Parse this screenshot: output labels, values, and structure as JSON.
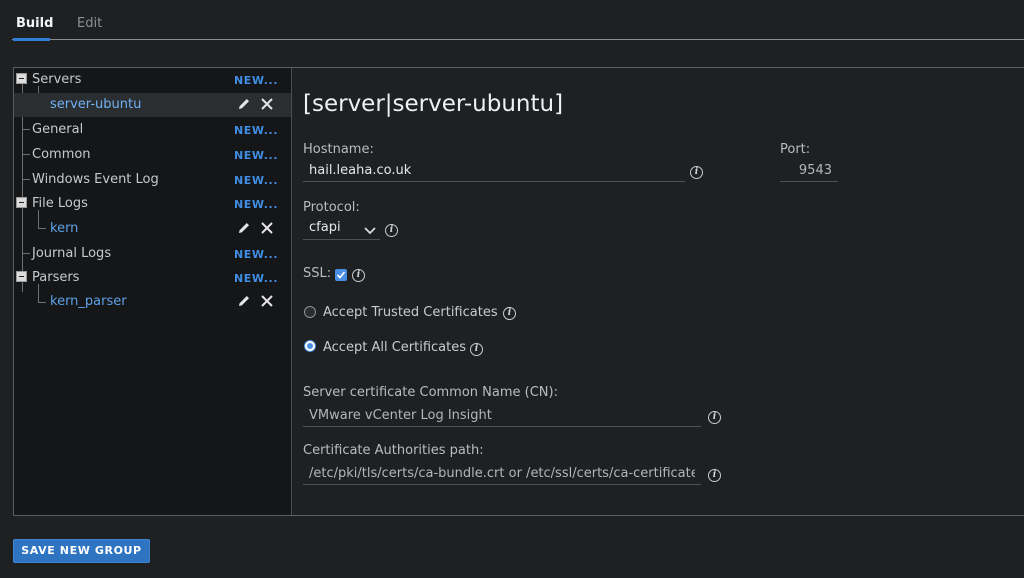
{
  "tabs": [
    {
      "label": "Build",
      "active": true
    },
    {
      "label": "Edit",
      "active": false
    }
  ],
  "tree": {
    "new_label": "NEW...",
    "servers": {
      "label": "Servers",
      "children": [
        {
          "label": "server-ubuntu",
          "selected": true
        }
      ]
    },
    "general": {
      "label": "General"
    },
    "common": {
      "label": "Common"
    },
    "windows_event_log": {
      "label": "Windows Event Log"
    },
    "file_logs": {
      "label": "File Logs",
      "children": [
        {
          "label": "kern"
        }
      ]
    },
    "journal_logs": {
      "label": "Journal Logs"
    },
    "parsers": {
      "label": "Parsers",
      "children": [
        {
          "label": "kern_parser"
        }
      ]
    }
  },
  "detail": {
    "title": "[server|server-ubuntu]",
    "hostname": {
      "label": "Hostname:",
      "value": "hail.leaha.co.uk"
    },
    "port": {
      "label": "Port:",
      "value": "9543"
    },
    "protocol": {
      "label": "Protocol:",
      "value": "cfapi"
    },
    "ssl": {
      "label": "SSL:",
      "checked": true
    },
    "radio_options": [
      {
        "label": "Accept Trusted Certificates",
        "selected": false
      },
      {
        "label": "Accept All Certificates",
        "selected": true
      }
    ],
    "common_name": {
      "label": "Server certificate Common Name (CN):",
      "value": "VMware vCenter Log Insight"
    },
    "ca_path": {
      "label": "Certificate Authorities path:",
      "value": "/etc/pki/tls/certs/ca-bundle.crt or /etc/ssl/certs/ca-certificates.crt"
    }
  },
  "footer": {
    "save_label": "SAVE NEW GROUP"
  },
  "colors": {
    "accent": "#2f7fd4",
    "link": "#3f8ee4",
    "leaf": "#5ea2ea"
  }
}
